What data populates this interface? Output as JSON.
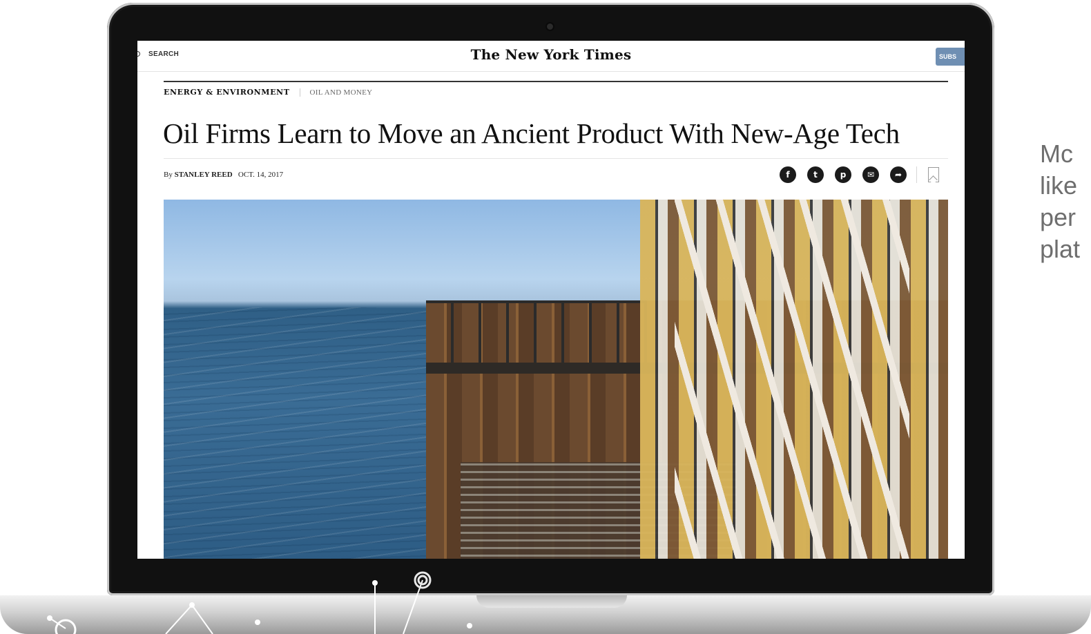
{
  "nyt": {
    "search_label": "SEARCH",
    "masthead": "The New York Times",
    "subscribe_label": "SUBS",
    "section": "ENERGY & ENVIRONMENT",
    "subsection": "OIL AND MONEY",
    "headline": "Oil Firms Learn to Move an Ancient Product With New-Age Tech",
    "byline_prefix": "By",
    "author": "STANLEY REED",
    "date": "OCT. 14, 2017",
    "share_icons": [
      "facebook-icon",
      "twitter-icon",
      "pinterest-icon",
      "email-icon",
      "share-icon",
      "bookmark-icon"
    ]
  },
  "side_text": {
    "lines": [
      "Mc",
      "like",
      "per",
      "plat"
    ]
  }
}
